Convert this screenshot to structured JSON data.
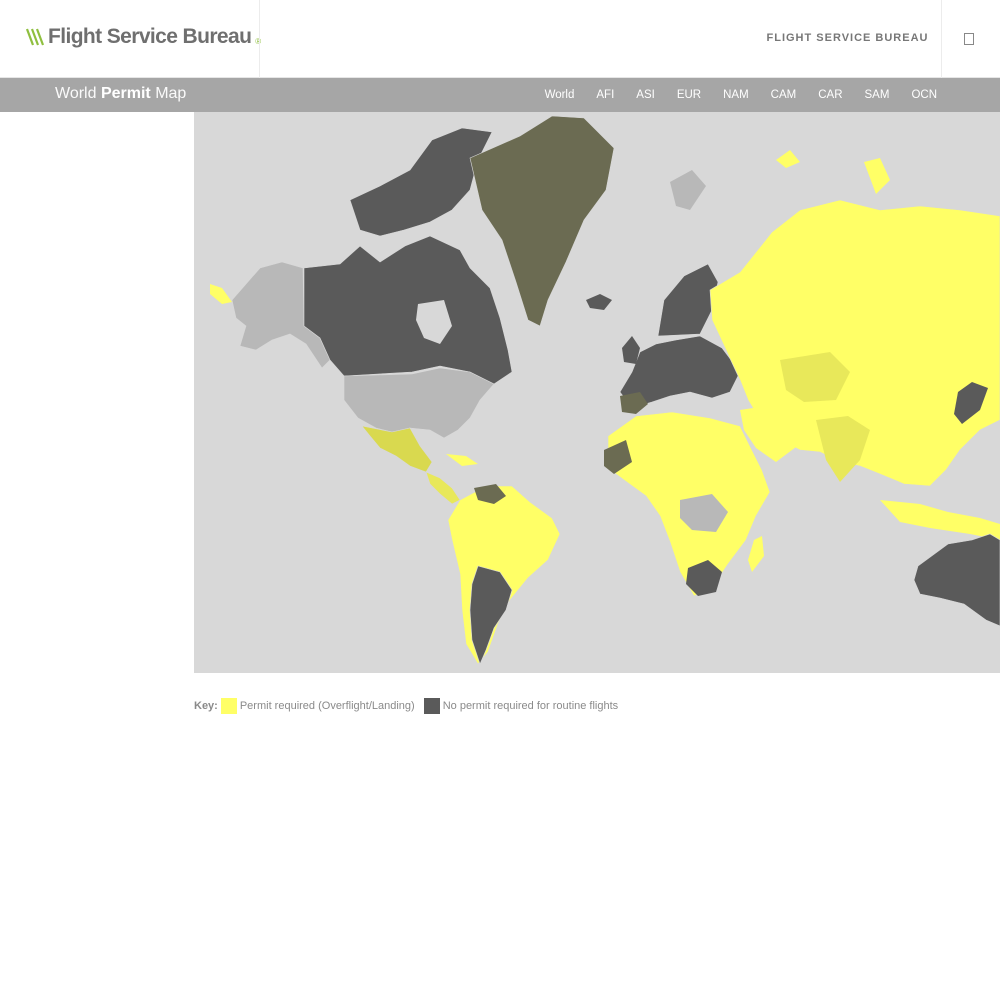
{
  "header": {
    "logo_text": "Flight Service Bureau",
    "logo_reg": "®",
    "brand_link": "FLIGHT SERVICE BUREAU",
    "menu_icon": "menu-icon"
  },
  "subbar": {
    "title_part1": "World",
    "title_part2": "Permit",
    "title_part3": "Map",
    "regions": [
      {
        "label": "World"
      },
      {
        "label": "AFI"
      },
      {
        "label": "ASI"
      },
      {
        "label": "EUR"
      },
      {
        "label": "NAM"
      },
      {
        "label": "CAM"
      },
      {
        "label": "CAR"
      },
      {
        "label": "SAM"
      },
      {
        "label": "OCN"
      }
    ]
  },
  "map": {
    "ocean_color": "#d8d8d8",
    "permit_color": "#ffff66",
    "no_permit_color": "#5a5a5a",
    "mixed_color": "#6b6b52",
    "unknown_color": "#b8b8b8"
  },
  "key": {
    "label": "Key:",
    "items": [
      {
        "label": "Permit required (Overflight/Landing)",
        "color": "#ffff66"
      },
      {
        "label": "No permit required for routine flights",
        "color": "#5a5a5a"
      }
    ]
  },
  "colors": {
    "accent_green": "#8fbf3f",
    "logo_gray": "#6f6f6f",
    "subbar_gray": "#a6a6a6"
  }
}
